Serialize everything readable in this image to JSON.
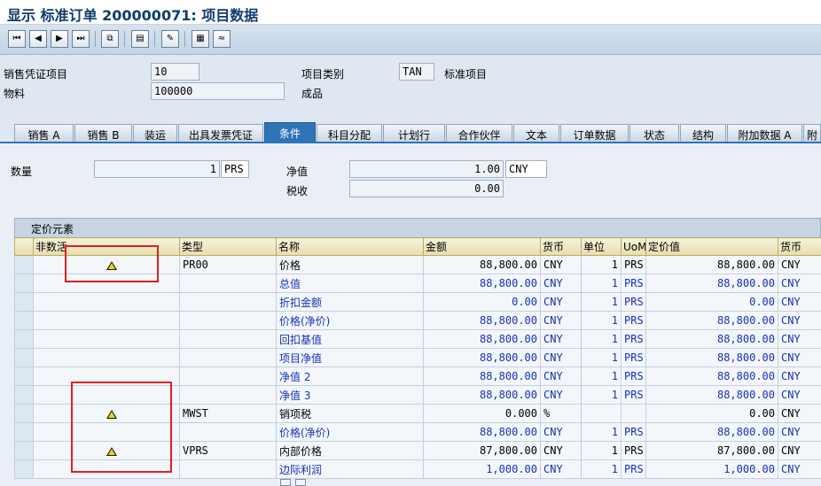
{
  "window": {
    "title": "显示 标准订单 200000071: 项目数据"
  },
  "toolbar": {
    "buttons": [
      {
        "name": "first-page-button",
        "glyph": "⏮"
      },
      {
        "name": "prev-page-button",
        "glyph": "◀"
      },
      {
        "name": "next-page-button",
        "glyph": "▶"
      },
      {
        "name": "last-page-button",
        "glyph": "⏭"
      },
      {
        "name": "copy-icon",
        "glyph": "⧉"
      },
      {
        "name": "document-icon",
        "glyph": "▤"
      },
      {
        "name": "edit-icon",
        "glyph": "✎"
      },
      {
        "name": "calculator-icon",
        "glyph": "▦"
      },
      {
        "name": "analysis-icon",
        "glyph": "≈"
      }
    ]
  },
  "header": {
    "item_label": "销售凭证项目",
    "item_value": "10",
    "material_label": "物料",
    "material_value": "100000",
    "material_desc": "成品",
    "category_label": "项目类别",
    "category_value": "TAN",
    "category_desc": "标准项目"
  },
  "tabs": [
    "销售 A",
    "销售 B",
    "装运",
    "出具发票凭证",
    "条件",
    "科目分配",
    "计划行",
    "合作伙伴",
    "文本",
    "订单数据",
    "状态",
    "结构",
    "附加数据 A",
    "附"
  ],
  "active_tab": "条件",
  "conditions": {
    "qty_label": "数量",
    "qty_value": "1",
    "qty_unit": "PRS",
    "net_label": "净值",
    "net_value": "1.00",
    "net_currency": "CNY",
    "tax_label": "税收",
    "tax_value": "0.00"
  },
  "grid": {
    "title": "定价元素",
    "columns": [
      "非数活",
      "类型",
      "名称",
      "金额",
      "货币",
      "单位",
      "UoM",
      "定价值",
      "货币"
    ],
    "rows": [
      {
        "warn": true,
        "type": "PR00",
        "name": "价格",
        "amount": "88,800.00",
        "curr": "CNY",
        "unit": "1",
        "uom": "PRS",
        "value": "88,800.00",
        "vcurr": "CNY",
        "blue": false
      },
      {
        "warn": false,
        "type": "",
        "name": "总值",
        "amount": "88,800.00",
        "curr": "CNY",
        "unit": "1",
        "uom": "PRS",
        "value": "88,800.00",
        "vcurr": "CNY",
        "blue": true
      },
      {
        "warn": false,
        "type": "",
        "name": "折扣金额",
        "amount": "0.00",
        "curr": "CNY",
        "unit": "1",
        "uom": "PRS",
        "value": "0.00",
        "vcurr": "CNY",
        "blue": true
      },
      {
        "warn": false,
        "type": "",
        "name": "价格(净价)",
        "amount": "88,800.00",
        "curr": "CNY",
        "unit": "1",
        "uom": "PRS",
        "value": "88,800.00",
        "vcurr": "CNY",
        "blue": true
      },
      {
        "warn": false,
        "type": "",
        "name": "回扣基值",
        "amount": "88,800.00",
        "curr": "CNY",
        "unit": "1",
        "uom": "PRS",
        "value": "88,800.00",
        "vcurr": "CNY",
        "blue": true
      },
      {
        "warn": false,
        "type": "",
        "name": "项目净值",
        "amount": "88,800.00",
        "curr": "CNY",
        "unit": "1",
        "uom": "PRS",
        "value": "88,800.00",
        "vcurr": "CNY",
        "blue": true
      },
      {
        "warn": false,
        "type": "",
        "name": "净值 2",
        "amount": "88,800.00",
        "curr": "CNY",
        "unit": "1",
        "uom": "PRS",
        "value": "88,800.00",
        "vcurr": "CNY",
        "blue": true
      },
      {
        "warn": false,
        "type": "",
        "name": "净值 3",
        "amount": "88,800.00",
        "curr": "CNY",
        "unit": "1",
        "uom": "PRS",
        "value": "88,800.00",
        "vcurr": "CNY",
        "blue": true
      },
      {
        "warn": true,
        "type": "MWST",
        "name": "销项税",
        "amount": "0.000",
        "curr": "%",
        "unit": "",
        "uom": "",
        "value": "0.00",
        "vcurr": "CNY",
        "blue": false
      },
      {
        "warn": false,
        "type": "",
        "name": "价格(净价)",
        "amount": "88,800.00",
        "curr": "CNY",
        "unit": "1",
        "uom": "PRS",
        "value": "88,800.00",
        "vcurr": "CNY",
        "blue": true
      },
      {
        "warn": true,
        "type": "VPRS",
        "name": "内部价格",
        "amount": "87,800.00",
        "curr": "CNY",
        "unit": "1",
        "uom": "PRS",
        "value": "87,800.00",
        "vcurr": "CNY",
        "blue": false
      },
      {
        "warn": false,
        "type": "",
        "name": "边际利润",
        "amount": "1,000.00",
        "curr": "CNY",
        "unit": "1",
        "uom": "PRS",
        "value": "1,000.00",
        "vcurr": "CNY",
        "blue": true
      }
    ]
  }
}
